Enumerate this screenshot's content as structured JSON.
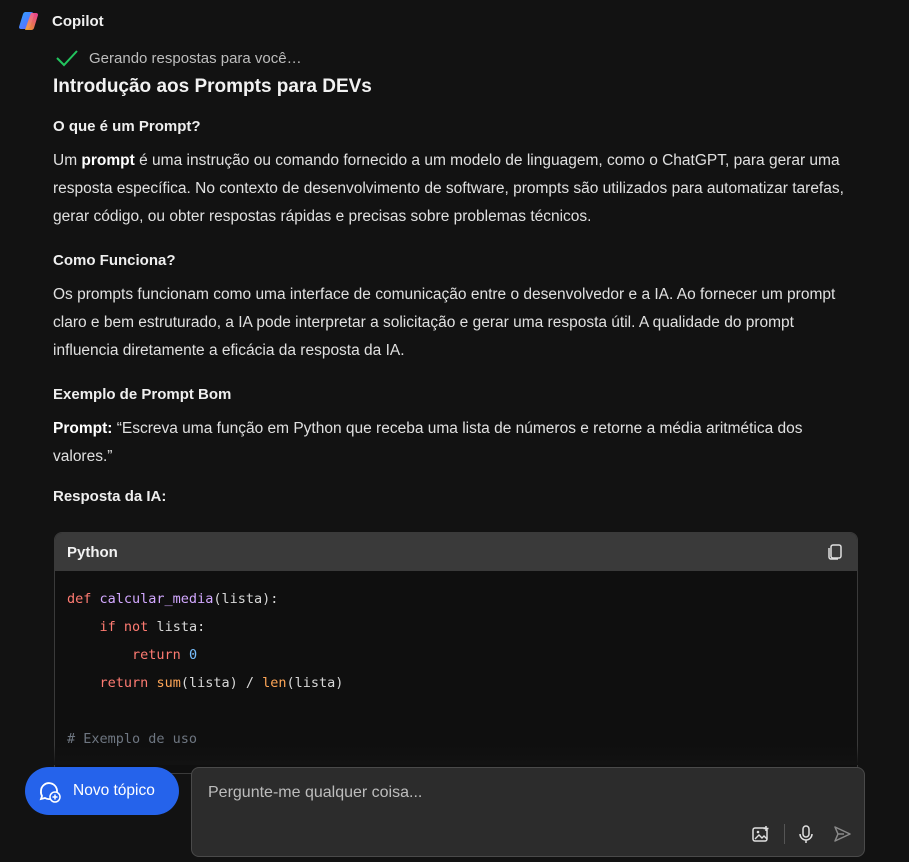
{
  "app": {
    "title": "Copilot"
  },
  "status": {
    "text": "Gerando respostas para você…"
  },
  "content": {
    "title": "Introdução aos Prompts para DEVs",
    "sections": {
      "what": {
        "heading": "O que é um Prompt?",
        "p1_prefix": "Um ",
        "p1_bold": "prompt",
        "p1_rest": " é uma instrução ou comando fornecido a um modelo de linguagem, como o ChatGPT, para gerar uma resposta específica. No contexto de desenvolvimento de software, prompts são utilizados para automatizar tarefas, gerar código, ou obter respostas rápidas e precisas sobre problemas técnicos."
      },
      "how": {
        "heading": "Como Funciona?",
        "p": "Os prompts funcionam como uma interface de comunicação entre o desenvolvedor e a IA. Ao fornecer um prompt claro e bem estruturado, a IA pode interpretar a solicitação e gerar uma resposta útil. A qualidade do prompt influencia diretamente a eficácia da resposta da IA."
      },
      "example": {
        "heading": "Exemplo de Prompt Bom",
        "prompt_label": "Prompt:",
        "prompt_text": " “Escreva uma função em Python que receba uma lista de números e retorne a média aritmética dos valores.”",
        "answer_label": "Resposta da IA:"
      }
    }
  },
  "code": {
    "language": "Python",
    "copy_icon": "copy-icon",
    "line1": {
      "kw": "def",
      "fn": "calcular_media",
      "rest": "(lista):"
    },
    "line2": {
      "kw1": "if",
      "kw2": "not",
      "rest": " lista:"
    },
    "line3": {
      "kw": "return",
      "num": "0"
    },
    "line4": {
      "kw": "return",
      "b1": "sum",
      "mid": "(lista) / ",
      "b2": "len",
      "rest": "(lista)"
    },
    "line6": {
      "comment": "# Exemplo de uso"
    }
  },
  "composer": {
    "new_topic_label": "Novo tópico",
    "placeholder": "Pergunte-me qualquer coisa...",
    "icons": [
      "image-add-icon",
      "microphone-icon",
      "send-icon"
    ]
  },
  "colors": {
    "accent": "#2563eb",
    "background": "#121212",
    "check": "#22c55e"
  }
}
